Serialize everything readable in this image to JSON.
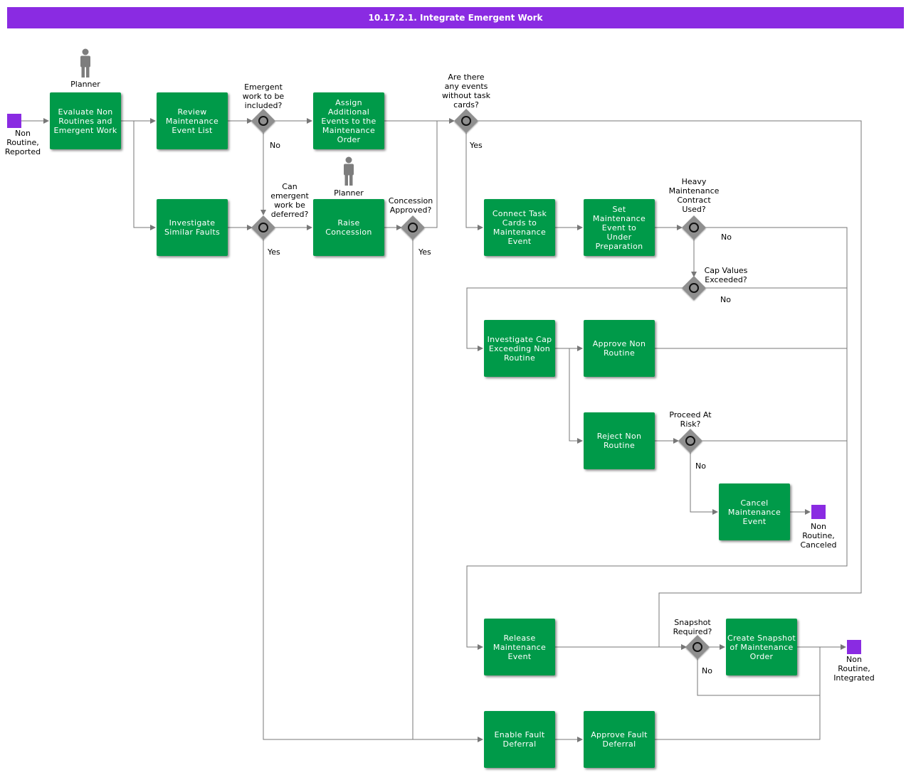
{
  "title": "10.17.2.1. Integrate Emergent Work",
  "colors": {
    "title_bar": "#8a2be2",
    "task": "#009a49",
    "event": "#8a2be2",
    "gateway": "#8f8f8f",
    "edge": "#777777"
  },
  "actors": {
    "planner_1": "Planner",
    "planner_2": "Planner"
  },
  "events": {
    "start": "Non\nRoutine,\nReported",
    "canceled": "Non\nRoutine,\nCanceled",
    "integrated": "Non\nRoutine,\nIntegrated"
  },
  "tasks": {
    "evaluate": "Evaluate Non\nRoutines and\nEmergent Work",
    "review": "Review\nMaintenance\nEvent List",
    "investigate_similar": "Investigate\nSimilar Faults",
    "assign": "Assign Additional\nEvents to the\nMaintenance\nOrder",
    "raise_concession": "Raise\nConcession",
    "connect_task_cards": "Connect Task\nCards to\nMaintenance\nEvent",
    "set_maintenance": "Set\nMaintenance\nEvent to\nUnder\nPreparation",
    "investigate_cap": "Investigate Cap\nExceeding Non\nRoutine",
    "approve_non_routine": "Approve Non\nRoutine",
    "reject_non_routine": "Reject Non\nRoutine",
    "cancel_event": "Cancel\nMaintenance\nEvent",
    "release_event": "Release\nMaintenance\nEvent",
    "create_snapshot": "Create Snapshot\nof Maintenance\nOrder",
    "enable_fault_deferral": "Enable Fault\nDeferral",
    "approve_fault_deferral": "Approve Fault\nDeferral"
  },
  "gateways": {
    "emergent_included": "Emergent\nwork to be\nincluded?",
    "can_defer": "Can\nemergent\nwork be\ndeferred?",
    "concession": "Concession\nApproved?",
    "events_without_cards": "Are there\nany events\nwithout task\ncards?",
    "heavy_contract": "Heavy\nMaintenance\nContract\nUsed?",
    "cap_exceeded": "Cap Values\nExceeded?",
    "proceed_at_risk": "Proceed At\nRisk?",
    "snapshot_required": "Snapshot\nRequired?"
  },
  "flow_labels": {
    "no_emergent": "No",
    "yes_defer": "Yes",
    "yes_concession": "Yes",
    "yes_events": "Yes",
    "no_heavy": "No",
    "no_cap": "No",
    "no_proceed": "No",
    "no_snapshot": "No"
  }
}
